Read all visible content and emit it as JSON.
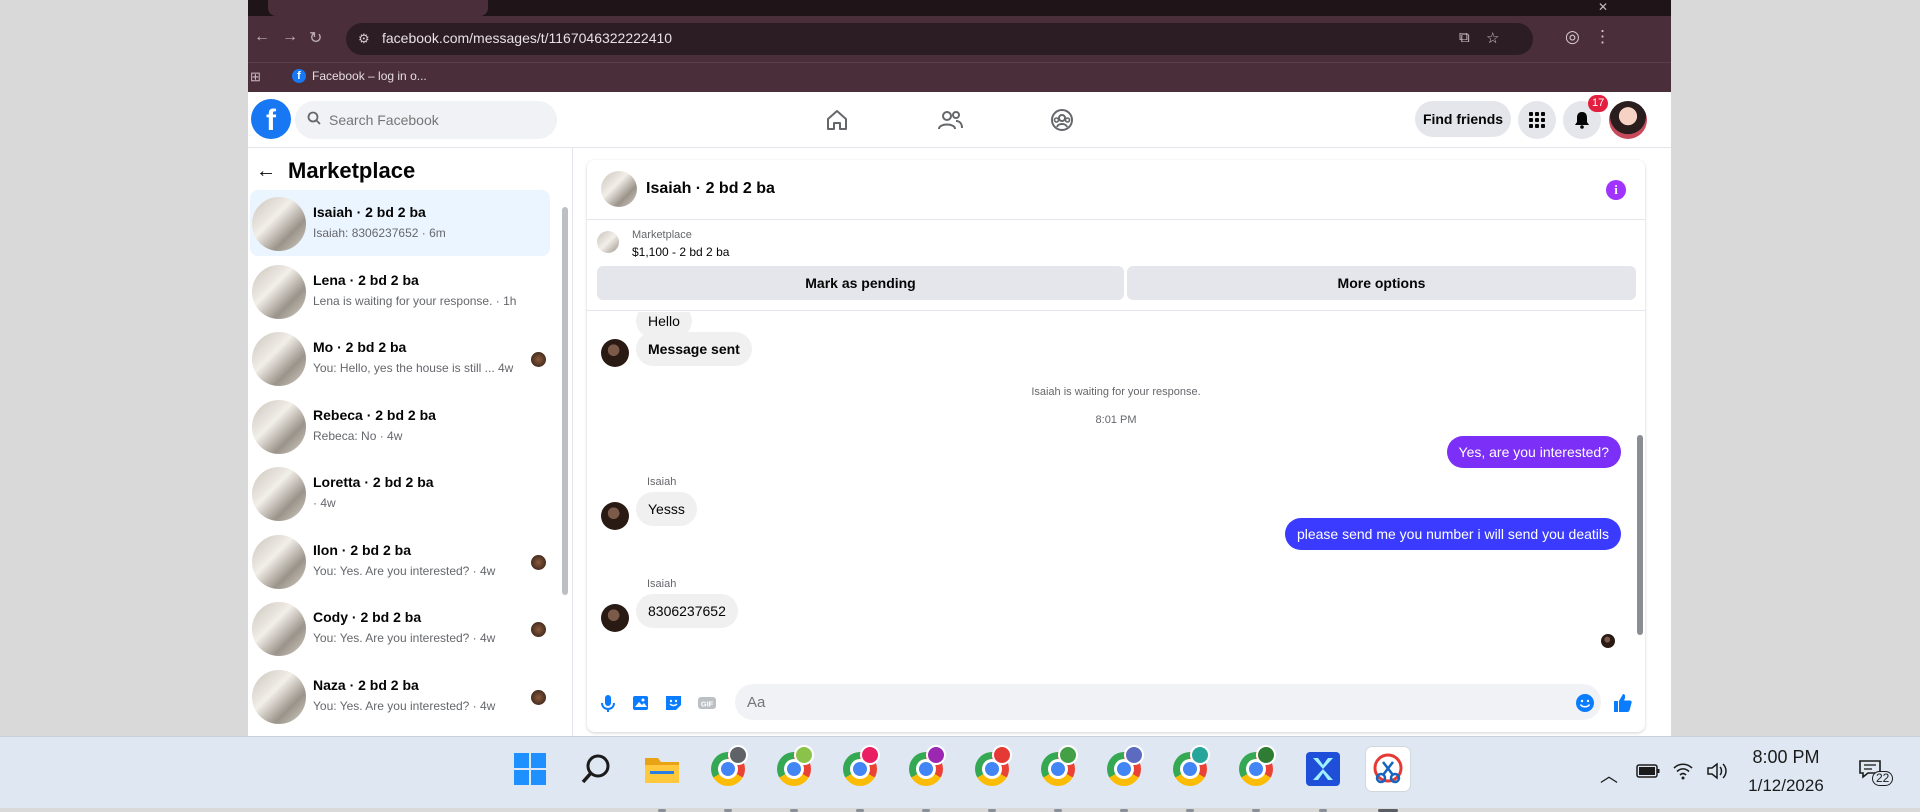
{
  "browser": {
    "url": "facebook.com/messages/t/1167046322222410",
    "bookmark_label": "Facebook – log in o..."
  },
  "header": {
    "search_placeholder": "Search Facebook",
    "find_friends_label": "Find friends",
    "notification_count": "17",
    "nav_icons": [
      "home-icon",
      "friends-icon",
      "groups-icon"
    ]
  },
  "sidebar": {
    "title": "Marketplace",
    "conversations": [
      {
        "title": "Isaiah · 2 bd 2 ba",
        "preview": "Isaiah: 8306237652 · 6m",
        "active": true,
        "seen": false
      },
      {
        "title": "Lena · 2 bd 2 ba",
        "preview": "Lena is waiting for your response. · 1h",
        "active": false,
        "seen": false
      },
      {
        "title": "Mo · 2 bd 2 ba",
        "preview": "You: Hello, yes the house is still ...   4w",
        "active": false,
        "seen": true
      },
      {
        "title": "Rebeca · 2 bd 2 ba",
        "preview": "Rebeca: No · 4w",
        "active": false,
        "seen": false
      },
      {
        "title": "Loretta · 2 bd 2 ba",
        "preview": " · 4w",
        "active": false,
        "seen": false
      },
      {
        "title": "Ilon · 2 bd 2 ba",
        "preview": "You: Yes. Are you interested? · 4w",
        "active": false,
        "seen": true
      },
      {
        "title": "Cody · 2 bd 2 ba",
        "preview": "You: Yes. Are you interested? · 4w",
        "active": false,
        "seen": true
      },
      {
        "title": "Naza · 2 bd 2 ba",
        "preview": "You: Yes. Are you interested? · 4w",
        "active": false,
        "seen": true
      }
    ]
  },
  "chat": {
    "title": "Isaiah · 2 bd 2 ba",
    "listing": {
      "category": "Marketplace",
      "price_line": "$1,100 - 2 bd 2 ba",
      "pending_label": "Mark as pending",
      "more_label": "More options"
    },
    "messages": {
      "hello": "Hello",
      "message_sent": "Message sent",
      "waiting": "Isaiah is waiting for your response.",
      "time": "8:01 PM",
      "out1": "Yes, are you interested?",
      "sender1": "Isaiah",
      "in1": "Yesss",
      "out2": "please send me you number i will send you deatils",
      "sender2": "Isaiah",
      "in2": "8306237652"
    },
    "composer_placeholder": "Aa"
  },
  "taskbar": {
    "time": "8:00 PM",
    "date": "1/12/2026",
    "notification_count": "22",
    "chrome_profile_colors": [
      "#5f6368",
      "#8bc34a",
      "#e91e63",
      "#9c27b0",
      "#e53935",
      "#43a047",
      "#5c6bc0",
      "#26a69a",
      "#2e7d32"
    ]
  }
}
